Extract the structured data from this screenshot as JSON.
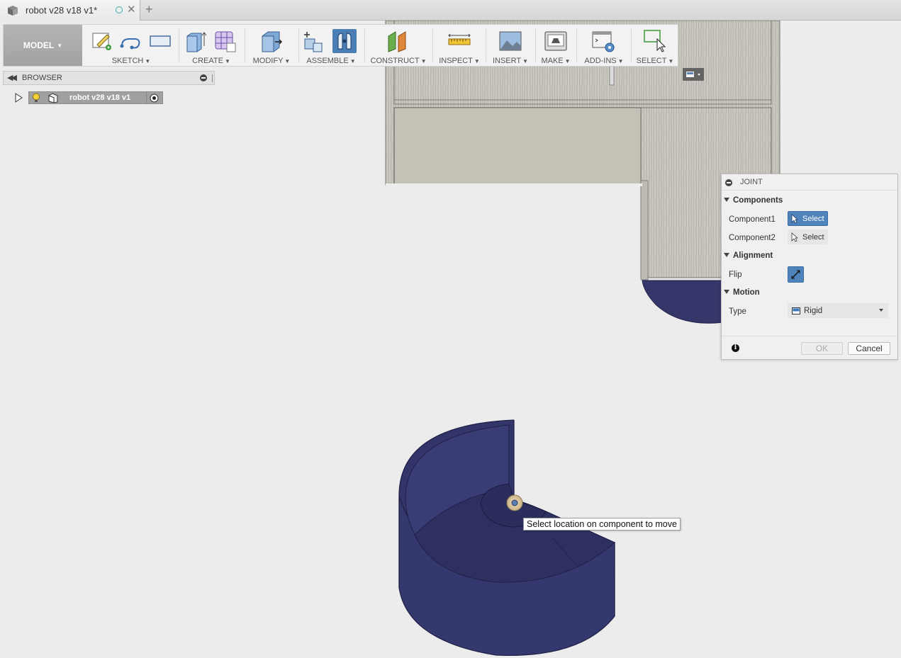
{
  "tab": {
    "title": "robot v28 v18 v1*",
    "close_symbol": "✕",
    "new_tab_symbol": "+"
  },
  "toolbar": {
    "workspace": "MODEL",
    "groups": [
      {
        "label": "SKETCH"
      },
      {
        "label": "CREATE"
      },
      {
        "label": "MODIFY"
      },
      {
        "label": "ASSEMBLE"
      },
      {
        "label": "CONSTRUCT"
      },
      {
        "label": "INSPECT"
      },
      {
        "label": "INSERT"
      },
      {
        "label": "MAKE"
      },
      {
        "label": "ADD-INS"
      },
      {
        "label": "SELECT"
      }
    ]
  },
  "browser": {
    "title": "BROWSER",
    "root_node": "robot v28 v18 v1"
  },
  "joint_dialog": {
    "title": "JOINT",
    "components_section": "Components",
    "component1_label": "Component1",
    "component1_button": "Select",
    "component2_label": "Component2",
    "component2_button": "Select",
    "alignment_section": "Alignment",
    "flip_label": "Flip",
    "motion_section": "Motion",
    "type_label": "Type",
    "type_value": "Rigid",
    "ok_label": "OK",
    "cancel_label": "Cancel",
    "info_symbol": "i"
  },
  "tooltip": {
    "text": "Select location on component to move"
  },
  "colors": {
    "accent": "#4f83bb",
    "part_color": "#3b3d6e",
    "wood_color": "#c9c6bb",
    "viewport_bg": "#ececec"
  }
}
